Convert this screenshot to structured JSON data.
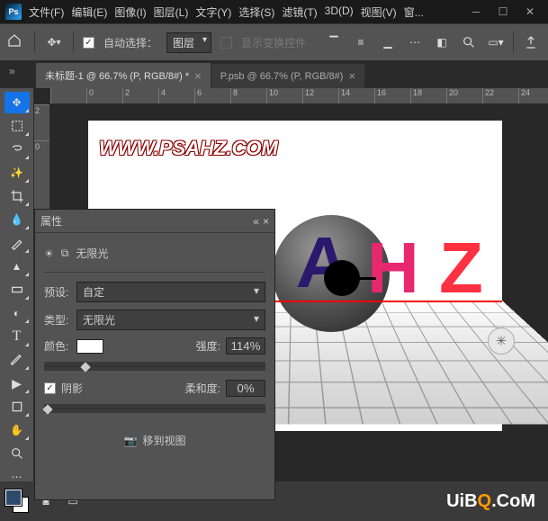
{
  "app": {
    "logo": "Ps"
  },
  "menu": {
    "file": "文件(F)",
    "edit": "编辑(E)",
    "image": "图像(I)",
    "layer": "图层(L)",
    "type": "文字(Y)",
    "select": "选择(S)",
    "filter": "滤镜(T)",
    "3d": "3D(D)",
    "view": "视图(V)",
    "window_trunc": "窗..."
  },
  "options": {
    "auto_select_label": "自动选择：",
    "auto_select_target": "图层",
    "show_transform": "显示变换控件"
  },
  "tabs": {
    "active": "未标题-1 @ 66.7% (P, RGB/8#) *",
    "inactive": "P.psb @ 66.7% (P, RGB/8#)"
  },
  "ruler_h": [
    "0",
    "2",
    "4",
    "6",
    "8",
    "10",
    "12",
    "14",
    "16",
    "18",
    "20",
    "22",
    "24"
  ],
  "ruler_v": [
    "2",
    "0"
  ],
  "canvas": {
    "watermark": "WWW.PSAHZ.COM",
    "letters": {
      "a": "A",
      "h": "H",
      "z": "Z"
    }
  },
  "panel": {
    "title": "属性",
    "light_name": "无限光",
    "preset_label": "预设:",
    "preset_value": "自定",
    "type_label": "类型:",
    "type_value": "无限光",
    "color_label": "颜色:",
    "intensity_label": "强度:",
    "intensity_value": "114%",
    "shadow_label": "阴影",
    "softness_label": "柔和度:",
    "softness_value": "0%",
    "move_to_view": "移到视图"
  },
  "branding": {
    "prefix": "UiB",
    "q": "Q",
    "suffix": ".CoM"
  }
}
